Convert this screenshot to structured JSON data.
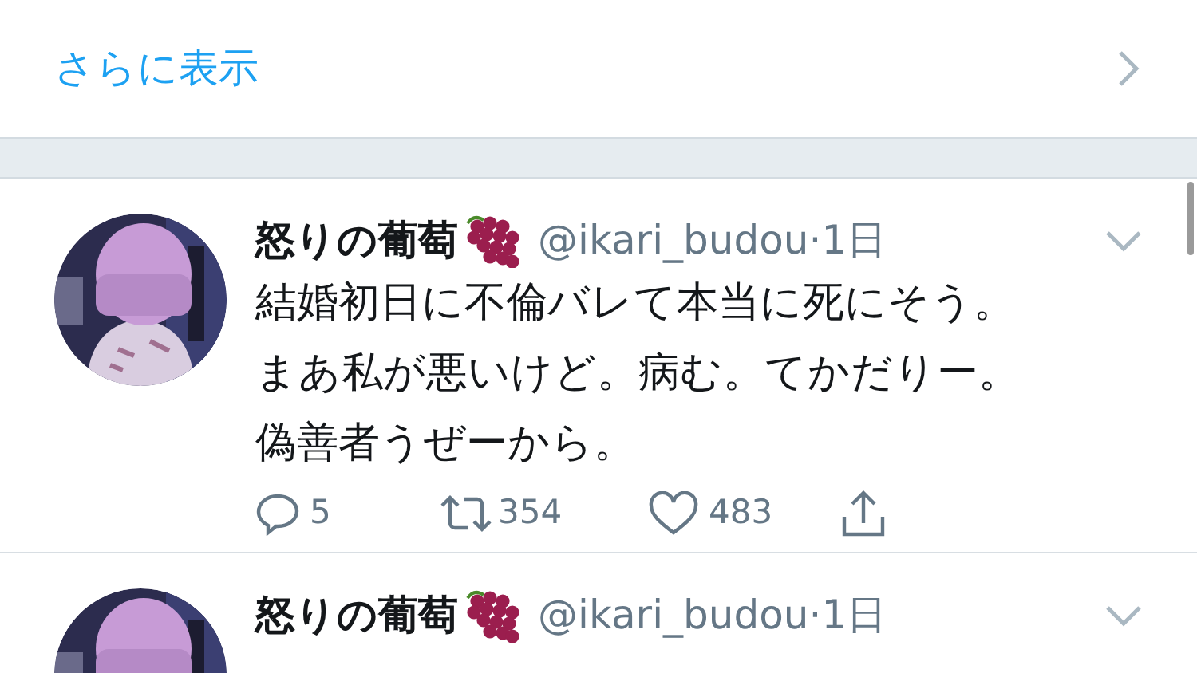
{
  "show_more": {
    "label": "さらに表示"
  },
  "tweets": [
    {
      "name": "怒りの葡萄",
      "handle": "@ikari_budou",
      "time": "·1日",
      "text_lines": [
        "結婚初日に不倫バレて本当に死にそう。",
        "まあ私が悪いけど。病む。てかだりー。",
        "偽善者うぜーから。"
      ],
      "replies": "5",
      "retweets": "354",
      "likes": "483"
    },
    {
      "name": "怒りの葡萄",
      "handle": "@ikari_budou",
      "time": "·1日"
    }
  ]
}
